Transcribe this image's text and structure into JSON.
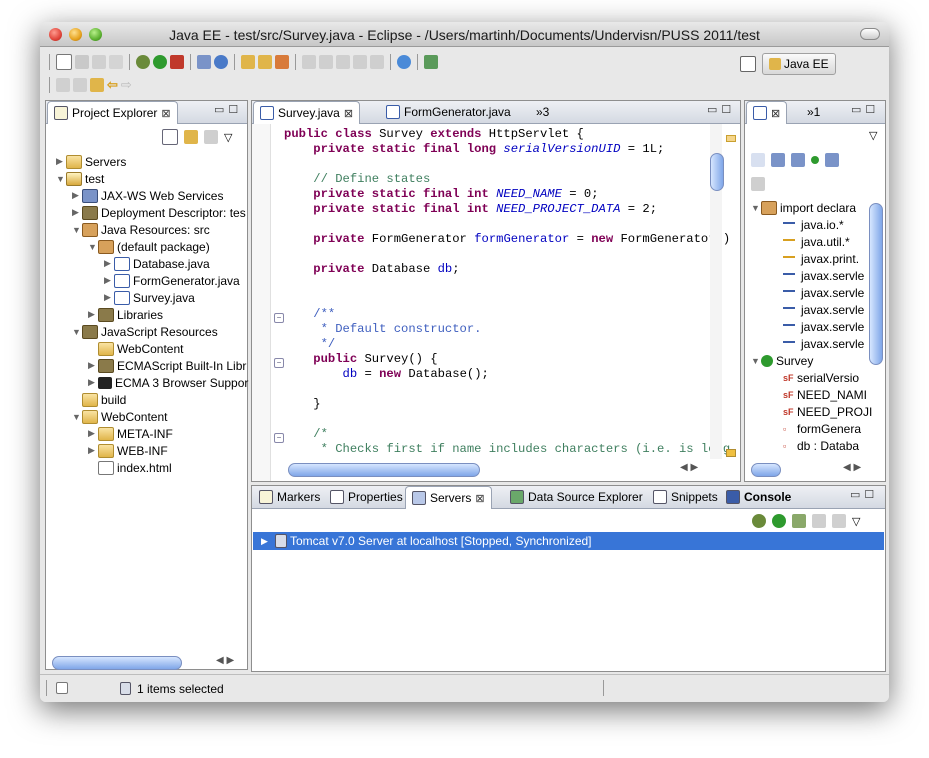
{
  "window": {
    "title": "Java EE - test/src/Survey.java - Eclipse - /Users/martinh/Documents/Undervisn/PUSS 2011/test"
  },
  "perspective": {
    "label": "Java EE"
  },
  "project_explorer": {
    "tab_label": "Project Explorer",
    "items": [
      {
        "label": "Servers"
      },
      {
        "label": "test"
      },
      {
        "label": "JAX-WS Web Services"
      },
      {
        "label": "Deployment Descriptor: tes"
      },
      {
        "label": "Java Resources: src"
      },
      {
        "label": "(default package)"
      },
      {
        "label": "Database.java"
      },
      {
        "label": "FormGenerator.java"
      },
      {
        "label": "Survey.java"
      },
      {
        "label": "Libraries"
      },
      {
        "label": "JavaScript Resources"
      },
      {
        "label": "WebContent"
      },
      {
        "label": "ECMAScript Built-In Libr"
      },
      {
        "label": "ECMA 3 Browser Suppor"
      },
      {
        "label": "build"
      },
      {
        "label": "WebContent"
      },
      {
        "label": "META-INF"
      },
      {
        "label": "WEB-INF"
      },
      {
        "label": "index.html"
      }
    ]
  },
  "editor": {
    "tabs": [
      {
        "label": "Survey.java"
      },
      {
        "label": "FormGenerator.java"
      },
      {
        "label": "»3"
      }
    ],
    "lines": {
      "l1a": "public class ",
      "l1b": "Survey ",
      "l1c": "extends ",
      "l1d": "HttpServlet {",
      "l2a": "private static final long ",
      "l2b": "serialVersionUID",
      "l2c": " = 1L;",
      "l4": "// Define states",
      "l5a": "private static final int ",
      "l5b": "NEED_NAME",
      "l5c": " = 0;",
      "l6a": "private static final int ",
      "l6b": "NEED_PROJECT_DATA",
      "l6c": " = 2;",
      "l8a": "private ",
      "l8b": "FormGenerator ",
      "l8c": "formGenerator",
      "l8d": " = ",
      "l8e": "new ",
      "l8f": "FormGenerator()",
      "l10a": "private ",
      "l10b": "Database ",
      "l10c": "db",
      "l10d": ";",
      "l13": "/**",
      "l14": " * Default constructor.",
      "l15": " */",
      "l16a": "public ",
      "l16b": "Survey() {",
      "l17a": "db",
      "l17b": " = ",
      "l17c": "new ",
      "l17d": "Database();",
      "l19": "}",
      "l21": "/*",
      "l22": " * Checks first if name includes characters (i.e. is long"
    }
  },
  "outline": {
    "tab_label": "»1",
    "items": [
      {
        "label": "import declara"
      },
      {
        "label": "java.io.*"
      },
      {
        "label": "java.util.*"
      },
      {
        "label": "javax.print."
      },
      {
        "label": "javax.servle"
      },
      {
        "label": "javax.servle"
      },
      {
        "label": "javax.servle"
      },
      {
        "label": "javax.servle"
      },
      {
        "label": "javax.servle"
      },
      {
        "label": "Survey"
      },
      {
        "label": "serialVersio"
      },
      {
        "label": "NEED_NAMI"
      },
      {
        "label": "NEED_PROJI"
      },
      {
        "label": "formGenera"
      },
      {
        "label": "db : Databa"
      }
    ]
  },
  "bottom": {
    "tabs": [
      {
        "label": "Markers"
      },
      {
        "label": "Properties"
      },
      {
        "label": "Servers"
      },
      {
        "label": "Data Source Explorer"
      },
      {
        "label": "Snippets"
      },
      {
        "label": "Console"
      }
    ],
    "server_row": "Tomcat v7.0 Server at localhost  [Stopped, Synchronized]"
  },
  "status": {
    "text": "1 items selected"
  },
  "colors": {
    "selection": "#3875d7",
    "keyword": "#7f0055",
    "field": "#0000c0",
    "comment": "#3f7f5f",
    "javadoc": "#3f5fbf"
  }
}
